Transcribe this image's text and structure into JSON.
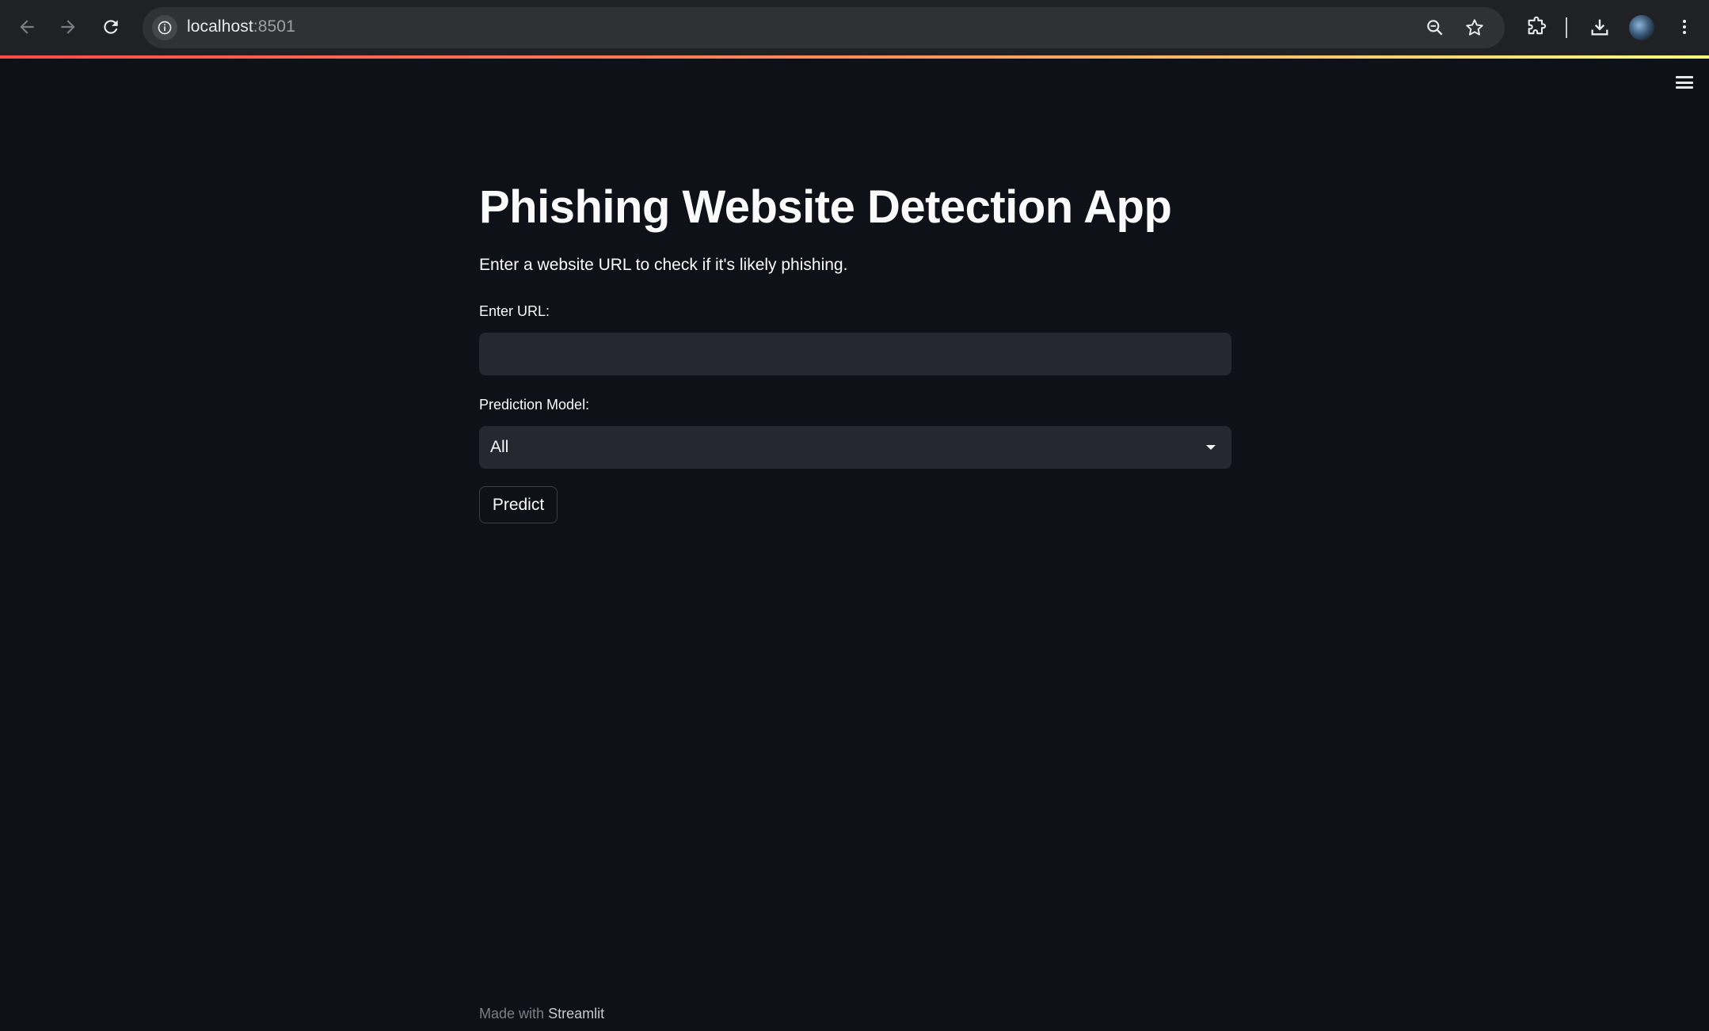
{
  "browser": {
    "url_host": "localhost",
    "url_port": ":8501"
  },
  "app": {
    "title": "Phishing Website Detection App",
    "subtitle": "Enter a website URL to check if it's likely phishing.",
    "url_field": {
      "label": "Enter URL:",
      "value": "",
      "placeholder": ""
    },
    "model_select": {
      "label": "Prediction Model:",
      "selected": "All"
    },
    "predict_label": "Predict",
    "footer": {
      "prefix": "Made with",
      "brand": "Streamlit"
    }
  },
  "colors": {
    "background": "#0e1117",
    "input_bg": "#262730",
    "text": "#fafafa",
    "chrome_bg": "#202124",
    "accent_gradient_start": "#ff4b4b",
    "accent_gradient_end": "#fffd80"
  }
}
